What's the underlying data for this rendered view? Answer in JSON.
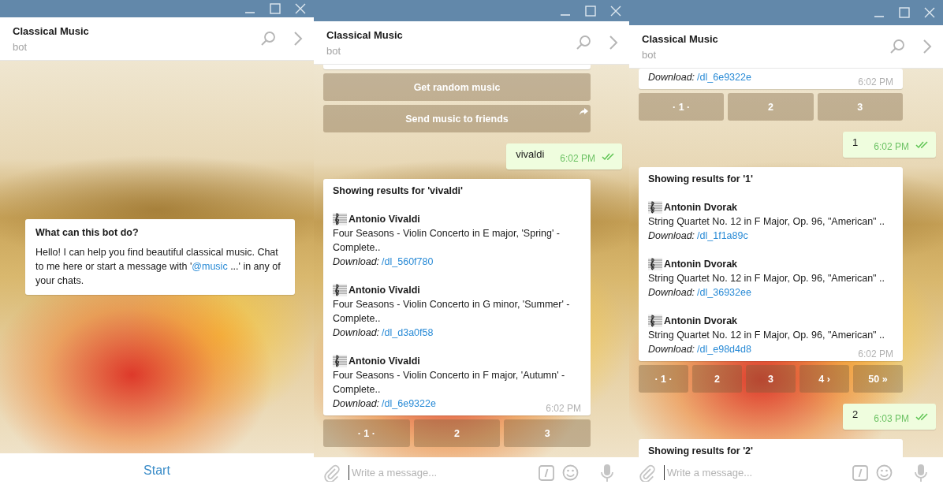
{
  "windows": [
    {
      "title": "Classical Music",
      "subtitle": "bot",
      "messages": [
        {
          "kind": "info",
          "heading": "What can this bot do?",
          "text_before": "Hello! I can help you find beautiful classical music. Chat to me here or start a message with '",
          "link": "@music",
          "text_after": " ...' in any of your chats."
        }
      ],
      "footer": {
        "kind": "start",
        "label": "Start"
      }
    },
    {
      "title": "Classical Music",
      "subtitle": "bot",
      "messages": [
        {
          "kind": "cut_card"
        },
        {
          "kind": "keyboard",
          "rows": [
            [
              {
                "label": "Get random music",
                "share": false
              }
            ],
            [
              {
                "label": "Send music to friends",
                "share": true
              }
            ]
          ]
        },
        {
          "kind": "outgoing",
          "text": "vivaldi",
          "time": "6:02 PM",
          "read": true
        },
        {
          "kind": "results",
          "heading": "Showing results for 'vivaldi'",
          "time": "6:02 PM",
          "entries": [
            {
              "artist": "Antonio Vivaldi",
              "title": "Four Seasons - Violin Concerto in E major, 'Spring' - Complete..",
              "download_label": "Download:",
              "download_link": "/dl_560f780"
            },
            {
              "artist": "Antonio Vivaldi",
              "title": "Four Seasons - Violin Concerto in G minor, 'Summer' - Complete..",
              "download_label": "Download:",
              "download_link": "/dl_d3a0f58"
            },
            {
              "artist": "Antonio Vivaldi",
              "title": "Four Seasons - Violin Concerto in F major, 'Autumn' - Complete..",
              "download_label": "Download:",
              "download_link": "/dl_6e9322e"
            }
          ]
        },
        {
          "kind": "keyboard",
          "rows": [
            [
              {
                "label": "· 1 ·",
                "share": false
              },
              {
                "label": "2",
                "share": false
              },
              {
                "label": "3",
                "share": false
              }
            ]
          ]
        }
      ],
      "footer": {
        "kind": "composer",
        "placeholder": "Write a message..."
      }
    },
    {
      "title": "Classical Music",
      "subtitle": "bot",
      "messages": [
        {
          "kind": "results",
          "time": "6:02 PM",
          "entries": [
            {
              "download_label": "Download:",
              "download_link": "/dl_6e9322e"
            }
          ]
        },
        {
          "kind": "keyboard",
          "rows": [
            [
              {
                "label": "· 1 ·",
                "share": false
              },
              {
                "label": "2",
                "share": false
              },
              {
                "label": "3",
                "share": false
              }
            ]
          ]
        },
        {
          "kind": "outgoing",
          "text": "1",
          "time": "6:02 PM",
          "read": true
        },
        {
          "kind": "results",
          "heading": "Showing results for '1'",
          "time": "6:02 PM",
          "entries": [
            {
              "artist": "Antonin Dvorak",
              "title": "String Quartet No. 12 in F Major, Op. 96, \"American\" ..",
              "download_label": "Download:",
              "download_link": "/dl_1f1a89c"
            },
            {
              "artist": "Antonin Dvorak",
              "title": "String Quartet No. 12 in F Major, Op. 96, \"American\" ..",
              "download_label": "Download:",
              "download_link": "/dl_36932ee"
            },
            {
              "artist": "Antonin Dvorak",
              "title": "String Quartet No. 12 in F Major, Op. 96, \"American\" ..",
              "download_label": "Download:",
              "download_link": "/dl_e98d4d8"
            }
          ]
        },
        {
          "kind": "keyboard",
          "rows": [
            [
              {
                "label": "· 1 ·",
                "share": false
              },
              {
                "label": "2",
                "share": false
              },
              {
                "label": "3",
                "share": false
              },
              {
                "label": "4 ›",
                "share": false
              },
              {
                "label": "50 »",
                "share": false
              }
            ]
          ]
        },
        {
          "kind": "outgoing",
          "text": "2",
          "time": "6:03 PM",
          "read": true
        },
        {
          "kind": "results",
          "heading": "Showing results for '2'"
        }
      ],
      "footer": {
        "kind": "composer",
        "placeholder": "Write a message..."
      }
    }
  ]
}
